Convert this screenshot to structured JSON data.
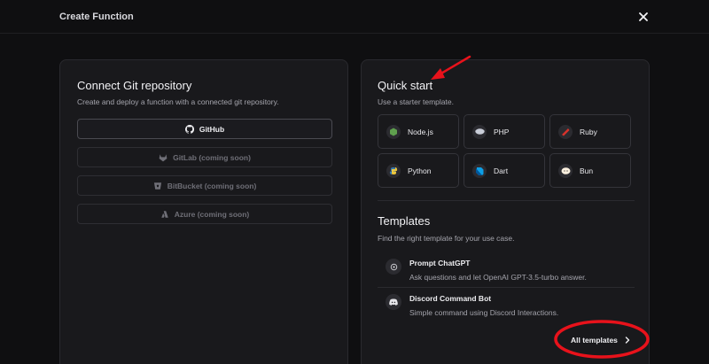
{
  "header": {
    "title": "Create Function",
    "close_icon": "close-icon"
  },
  "git": {
    "title": "Connect Git repository",
    "subtitle": "Create and deploy a function with a connected git repository.",
    "providers": [
      {
        "label": "GitHub",
        "icon": "github-icon",
        "enabled": true
      },
      {
        "label": "GitLab (coming soon)",
        "icon": "gitlab-icon",
        "enabled": false
      },
      {
        "label": "BitBucket (coming soon)",
        "icon": "bitbucket-icon",
        "enabled": false
      },
      {
        "label": "Azure (coming soon)",
        "icon": "azure-icon",
        "enabled": false
      }
    ]
  },
  "quickstart": {
    "title": "Quick start",
    "subtitle": "Use a starter template.",
    "runtimes": [
      {
        "label": "Node.js",
        "icon": "nodejs-icon",
        "color": "#5fa04e"
      },
      {
        "label": "PHP",
        "icon": "php-icon",
        "color": "#8892bf"
      },
      {
        "label": "Ruby",
        "icon": "ruby-icon",
        "color": "#d8322b"
      },
      {
        "label": "Python",
        "icon": "python-icon",
        "color": "#3776ab"
      },
      {
        "label": "Dart",
        "icon": "dart-icon",
        "color": "#0d9fe6"
      },
      {
        "label": "Bun",
        "icon": "bun-icon",
        "color": "#fbf0df"
      }
    ]
  },
  "templates": {
    "title": "Templates",
    "subtitle": "Find the right template for your use case.",
    "items": [
      {
        "name": "Prompt ChatGPT",
        "desc": "Ask questions and let OpenAI GPT-3.5-turbo answer.",
        "icon": "openai-icon"
      },
      {
        "name": "Discord Command Bot",
        "desc": "Simple command using Discord Interactions.",
        "icon": "discord-icon"
      }
    ],
    "all_label": "All templates"
  },
  "annotation_color": "#e8121b"
}
